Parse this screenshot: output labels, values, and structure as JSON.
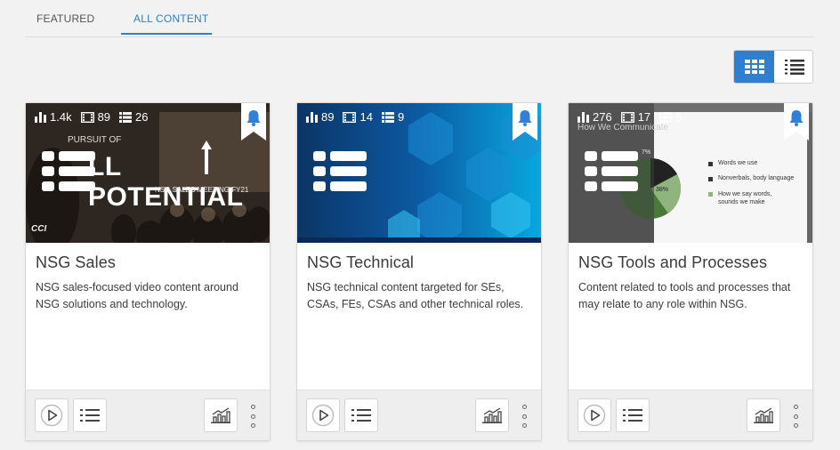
{
  "tabs": [
    {
      "label": "FEATURED",
      "active": false
    },
    {
      "label": "ALL CONTENT",
      "active": true
    }
  ],
  "view_toggle": {
    "active": "grid",
    "options": [
      "grid-view-icon",
      "list-view-icon"
    ]
  },
  "colors": {
    "accent": "#2e7fd0",
    "bookmark": "#2f80d6",
    "footer_bg": "#eeeeee"
  },
  "cards": [
    {
      "stats": {
        "views": "1.4k",
        "videos": "89",
        "items": "26"
      },
      "thumb_text": {
        "pursuit": "PURSUIT OF",
        "title": "LL POTENTIAL",
        "subtitle": "NSG SALES MEETING FY21",
        "logo": "CCI"
      },
      "title": "NSG Sales",
      "description": "NSG sales-focused video content around NSG solutions and technology."
    },
    {
      "stats": {
        "views": "89",
        "videos": "14",
        "items": "9"
      },
      "title": "NSG Technical",
      "description": "NSG technical content targeted for SEs, CSAs, FEs, CSAs and other technical roles."
    },
    {
      "stats": {
        "views": "276",
        "videos": "17",
        "items": "5"
      },
      "thumb_text": {
        "slide_heading": "How We Communicate",
        "pie_label_a": "7%",
        "pie_label_b": "38%",
        "legend": [
          "Words we use",
          "Nonverbals, body language",
          "How we say words, sounds we make"
        ]
      },
      "title": "NSG Tools and Processes",
      "description": "Content related to tools and processes that may relate to any role within NSG."
    }
  ]
}
